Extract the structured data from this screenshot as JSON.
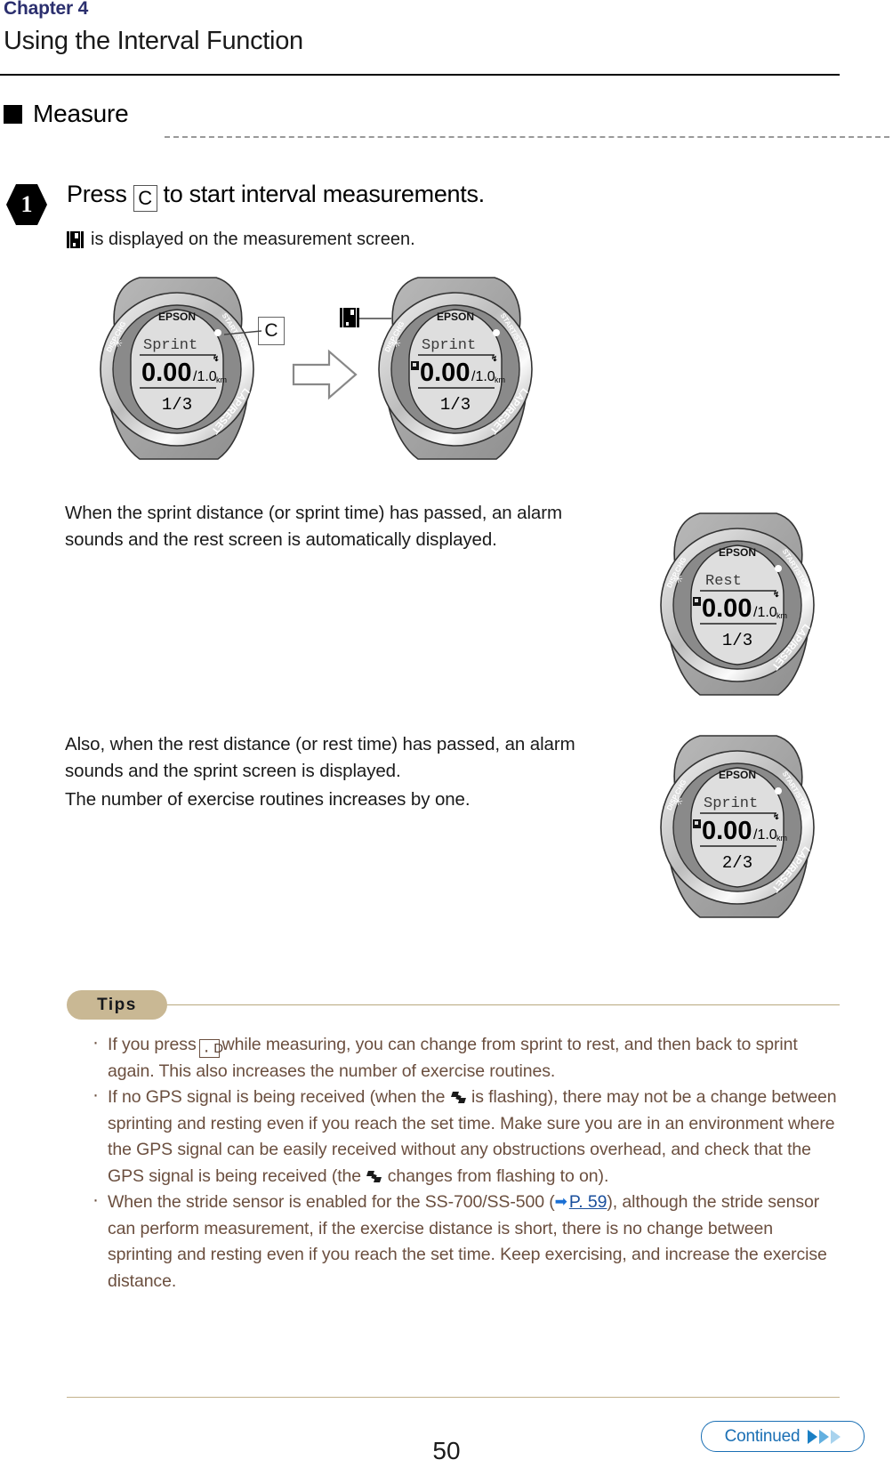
{
  "header": {
    "chapter_label": "Chapter 4",
    "chapter_title": "Using the Interval Function"
  },
  "section": {
    "title": "Measure",
    "bullet_icon": "square-bullet-icon"
  },
  "step1": {
    "number": "1",
    "heading_before": "Press",
    "key": "C",
    "heading_after": "to start interval measurements.",
    "subline": "is displayed on the measurement screen.",
    "subline_icon": "lap-indicator-icon"
  },
  "watches": {
    "before": {
      "brand": "EPSON",
      "mode": "Sprint",
      "value": "0.00",
      "target": "/1.0",
      "unit": "km",
      "routine": "1/3",
      "left_button": "DISP.CHG",
      "right_top_button": "START/STOP",
      "right_bottom_button": "LAP/RESET",
      "lap_icon_visible": false
    },
    "after": {
      "brand": "EPSON",
      "mode": "Sprint",
      "value": "0.00",
      "target": "/1.0",
      "unit": "km",
      "routine": "1/3",
      "left_button": "DISP.CHG",
      "right_top_button": "START/STOP",
      "right_bottom_button": "LAP/RESET",
      "lap_icon_visible": true
    },
    "rest": {
      "brand": "EPSON",
      "mode": "Rest",
      "value": "0.00",
      "target": "/1.0",
      "unit": "km",
      "routine": "1/3",
      "left_button": "DISP.CHG",
      "right_top_button": "START/STOP",
      "right_bottom_button": "LAP/RESET",
      "lap_icon_visible": true
    },
    "sprint2": {
      "brand": "EPSON",
      "mode": "Sprint",
      "value": "0.00",
      "target": "/1.0",
      "unit": "km",
      "routine": "2/3",
      "left_button": "DISP.CHG",
      "right_top_button": "START/STOP",
      "right_bottom_button": "LAP/RESET",
      "lap_icon_visible": true
    },
    "callout_key": "C",
    "callout_icon": "lap-indicator-icon"
  },
  "paragraphs": {
    "rest_screen": "When the sprint distance (or sprint time) has passed, an alarm sounds and the rest screen is automatically displayed.",
    "sprint_screen": "Also, when the rest distance (or rest time) has passed, an alarm sounds and the sprint screen is displayed.",
    "routines": "The number of exercise routines increases by one."
  },
  "tips": {
    "badge_label": "Tips",
    "items": [
      {
        "before_key": "If you press",
        "key": "D",
        "after_key": "while measuring, you can change from sprint to rest, and then back to sprint again. This also increases the number of exercise routines."
      },
      {
        "part1": "If no GPS signal is being received (when the",
        "icon1": "gps-signal-icon",
        "part2": "is flashing), there may not be a change between sprinting and resting even if you reach the set time. Make sure you are in an environment where the GPS signal can be easily received without any obstructions overhead, and check that the GPS signal is being received (the",
        "icon2": "gps-signal-icon",
        "part3": "changes from flashing to on)."
      },
      {
        "part1": "When the stride sensor is enabled for the SS-700/SS-500 (",
        "link_arrow": "➡",
        "link": "P. 59",
        "part2": "), although the stride sensor can perform measurement, if the exercise distance is short, there is no change between sprinting and resting even if you reach the set time. Keep exercising, and increase the exercise distance."
      }
    ]
  },
  "footer": {
    "continued_label": "Continued",
    "page_number": "50"
  },
  "colors": {
    "chapter_accent": "#2b2f6e",
    "tips_badge": "#c9b894",
    "tips_text": "#6b4f3f",
    "link": "#1a4f9c",
    "continued_blue": "#1a6fb4"
  }
}
